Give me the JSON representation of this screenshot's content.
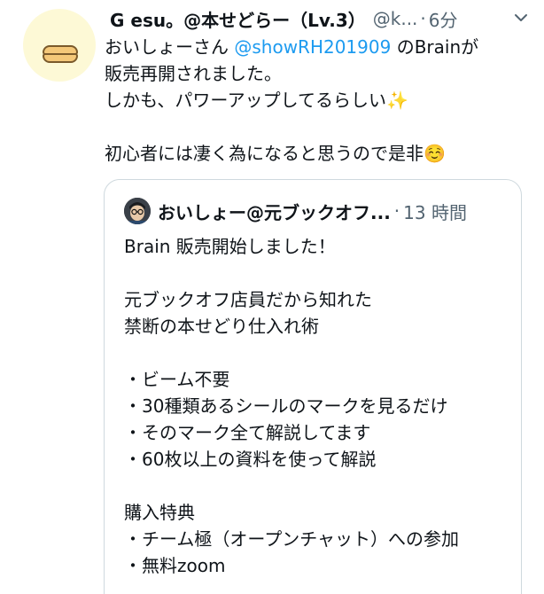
{
  "tweet": {
    "author_name": "G esu。@本せどらー（Lv.3）",
    "handle": "@k...",
    "dot": "·",
    "time": "6分",
    "text_line1_prefix": "おいしょーさん ",
    "mention": "@showRH201909",
    "text_line1_suffix": " のBrainが",
    "text_rest": "販売再開されました。\nしかも、パワーアップしてるらしい✨\n\n初心者には凄く為になると思うので是非☺️"
  },
  "quote": {
    "author_name": "おいしょー@元ブックオフ...",
    "dot": "·",
    "time": "13 時間",
    "text": "Brain 販売開始しました！\n\n元ブックオフ店員だから知れた\n禁断の本せどり仕入れ術\n\n・ビーム不要\n・30種類あるシールのマークを見るだけ\n・そのマーク全て解説してます\n・60枚以上の資料を使って解説\n\n購入特典\n・チーム極（オープンチャット）への参加\n・無料zoom"
  },
  "icons": {
    "avatar": "duck-avatar",
    "quote_avatar": "person-with-glasses-avatar",
    "menu": "chevron-down-icon"
  },
  "colors": {
    "mention": "#1d9bf0",
    "secondary_text": "#536471",
    "border": "#cfd9de"
  }
}
